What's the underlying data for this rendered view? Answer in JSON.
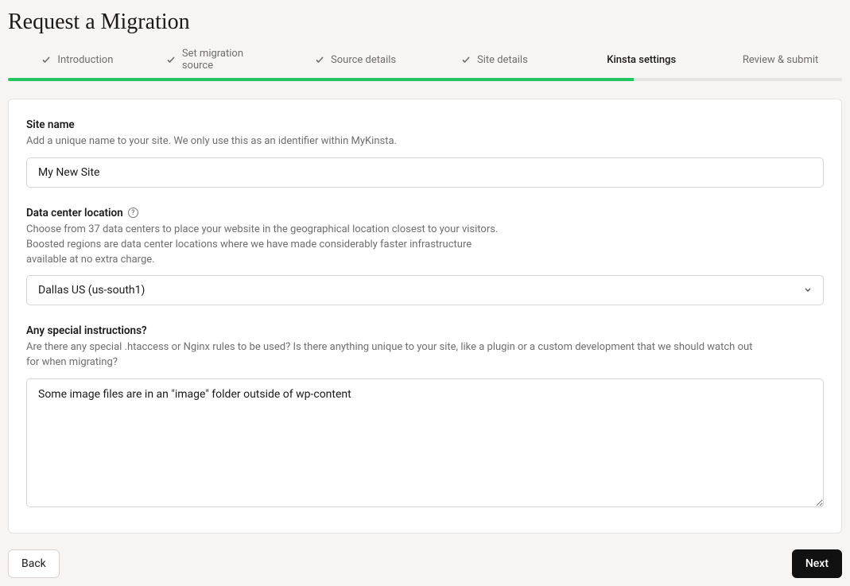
{
  "page": {
    "title": "Request a Migration"
  },
  "steps": [
    {
      "label": "Introduction",
      "completed": true,
      "active": false
    },
    {
      "label": "Set migration source",
      "completed": true,
      "active": false
    },
    {
      "label": "Source details",
      "completed": true,
      "active": false
    },
    {
      "label": "Site details",
      "completed": true,
      "active": false
    },
    {
      "label": "Kinsta settings",
      "completed": false,
      "active": true
    },
    {
      "label": "Review & submit",
      "completed": false,
      "active": false
    }
  ],
  "progress_percent": 75,
  "form": {
    "site_name": {
      "label": "Site name",
      "help": "Add a unique name to your site. We only use this as an identifier within MyKinsta.",
      "value": "My New Site"
    },
    "data_center": {
      "label": "Data center location",
      "help": "Choose from 37 data centers to place your website in the geographical location closest to your visitors. Boosted regions are data center locations where we have made considerably faster infrastructure available at no extra charge.",
      "value": "Dallas US (us-south1)"
    },
    "special_instructions": {
      "label": "Any special instructions?",
      "help": "Are there any special .htaccess or Nginx rules to be used? Is there anything unique to your site, like a plugin or a custom development that we should watch out for when migrating?",
      "value": "Some image files are in an \"image\" folder outside of wp-content"
    }
  },
  "actions": {
    "back": "Back",
    "next": "Next"
  }
}
